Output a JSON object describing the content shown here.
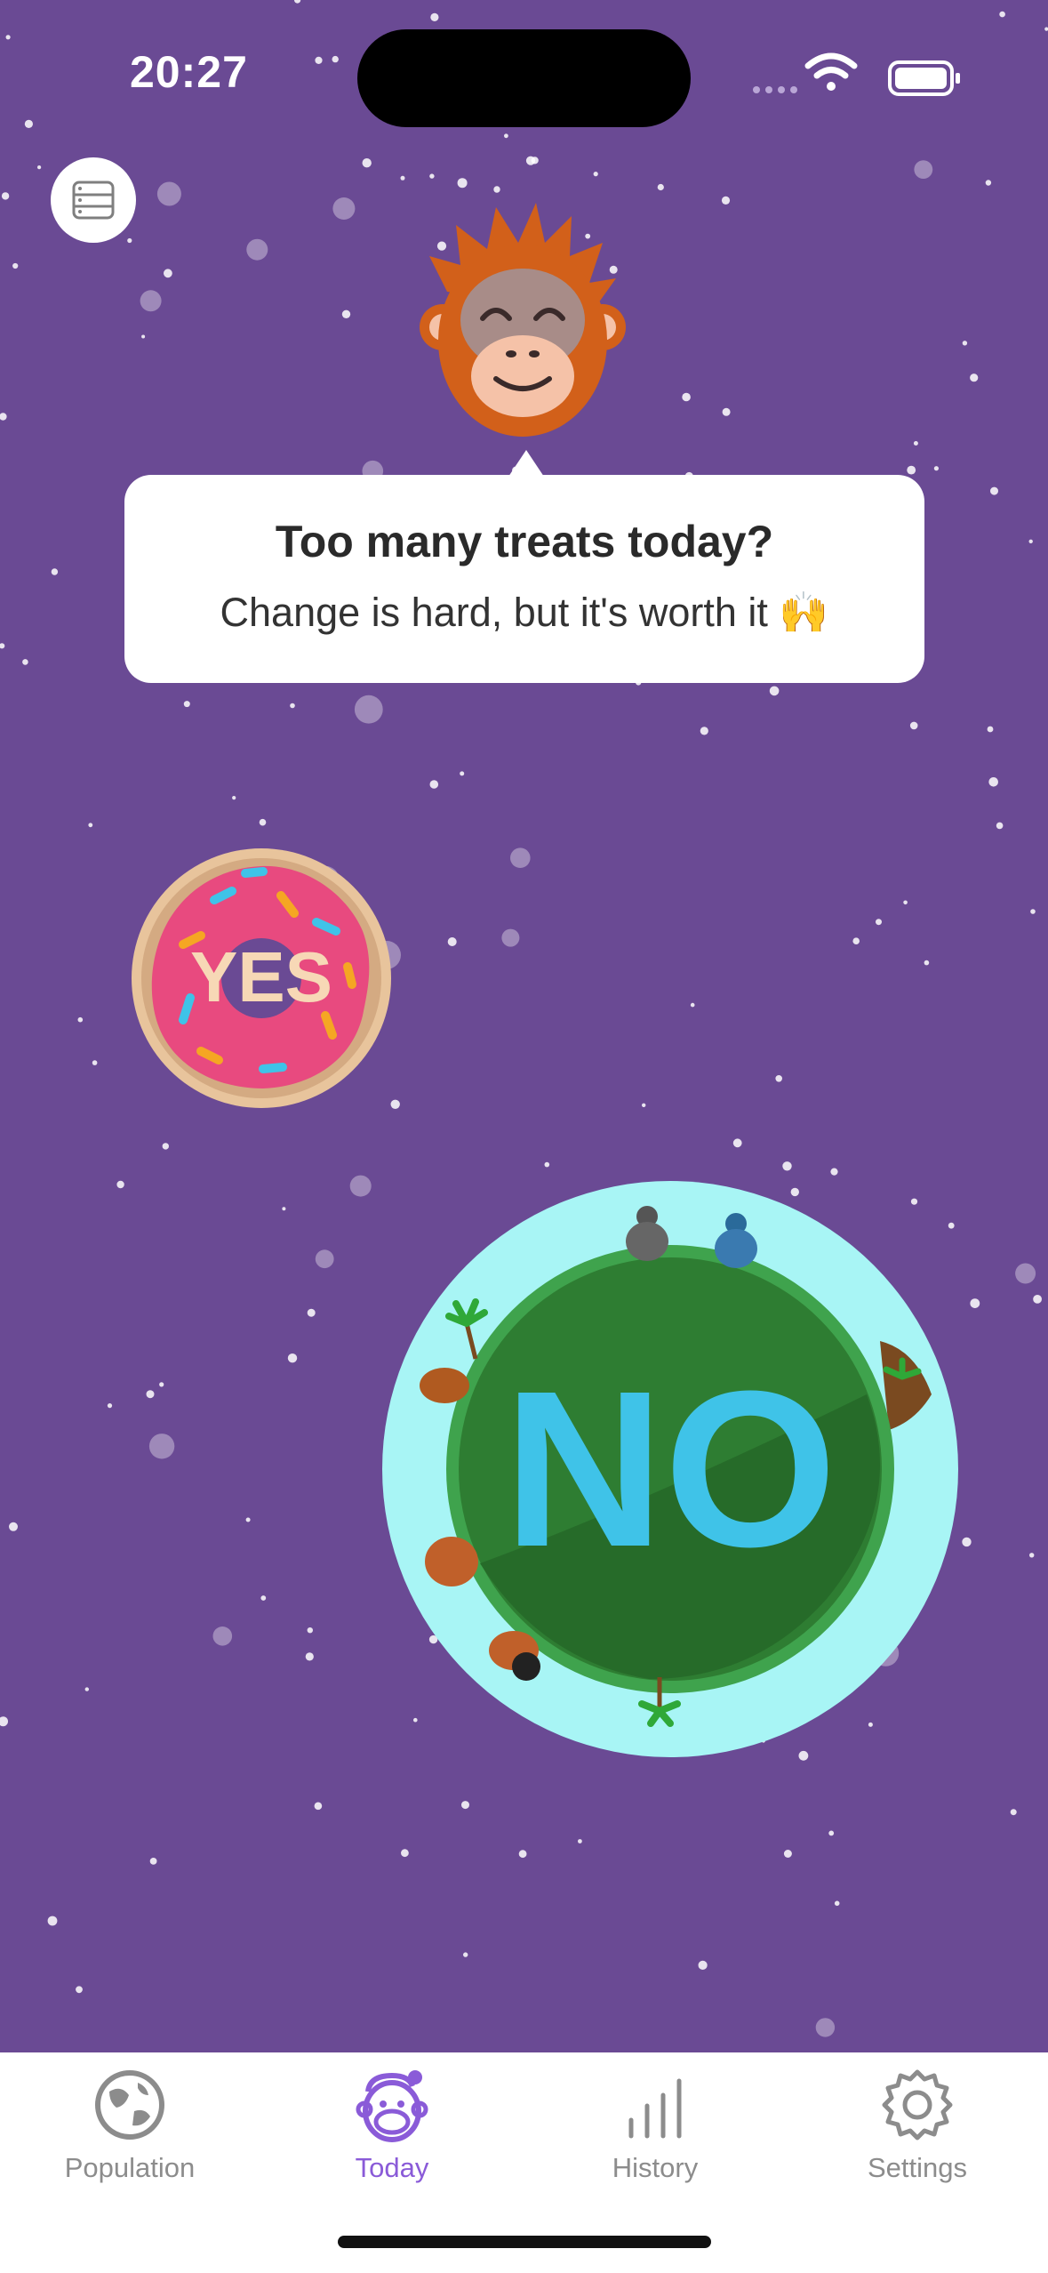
{
  "status_bar": {
    "time": "20:27"
  },
  "prompt": {
    "title": "Too many treats today?",
    "subtitle": "Change is hard, but it's worth it 🙌"
  },
  "choices": {
    "yes_label": "YES",
    "no_label": "NO"
  },
  "tabs": [
    {
      "label": "Population",
      "icon": "globe-icon",
      "active": false
    },
    {
      "label": "Today",
      "icon": "monkey-icon",
      "active": true
    },
    {
      "label": "History",
      "icon": "bar-chart-icon",
      "active": false
    },
    {
      "label": "Settings",
      "icon": "gear-icon",
      "active": false
    }
  ],
  "colors": {
    "background": "#6a4a94",
    "accent": "#8a5bd8",
    "donut_frosting": "#e84a7f",
    "planet_ring": "#a8f5f5",
    "planet": "#2e7d32",
    "no_text": "#3fc3e8"
  }
}
